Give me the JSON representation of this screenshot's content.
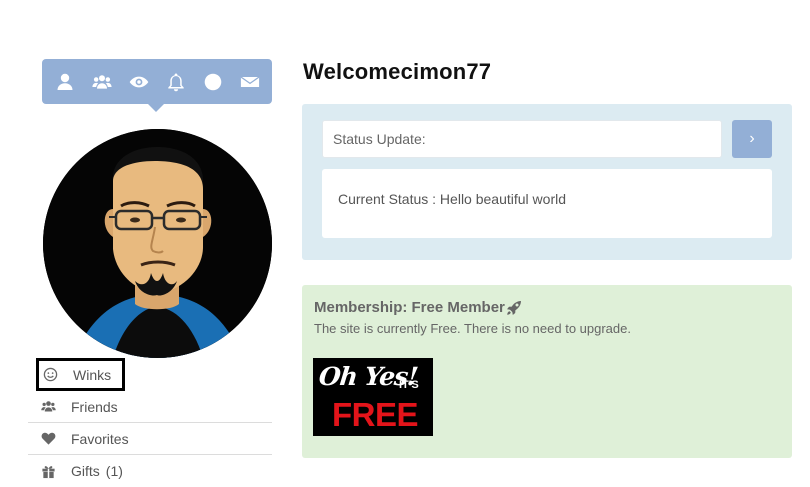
{
  "sidebar": {
    "toolbar_icons": [
      "user-icon",
      "users-icon",
      "eye-icon",
      "bell-icon",
      "circle-icon",
      "envelope-icon"
    ],
    "menu": {
      "winks": "Winks",
      "friends": "Friends",
      "favorites": "Favorites",
      "gifts": "Gifts",
      "gifts_count": "(1)"
    }
  },
  "main": {
    "welcome": "Welcomecimon77",
    "status": {
      "placeholder": "Status Update:",
      "button_icon": "chevron-right-icon",
      "current": "Current Status : Hello beautiful world"
    },
    "membership": {
      "title": "Membership: Free Member",
      "description": "The site is currently Free. There is no need to upgrade.",
      "badge": {
        "line1": "Oh Yes!",
        "its": "IT'S",
        "free": "FREE"
      }
    }
  },
  "colors": {
    "accent": "#93afd6",
    "status_panel": "#dcebf2",
    "membership_panel": "#dff0d8",
    "free_red": "#e3141a"
  }
}
